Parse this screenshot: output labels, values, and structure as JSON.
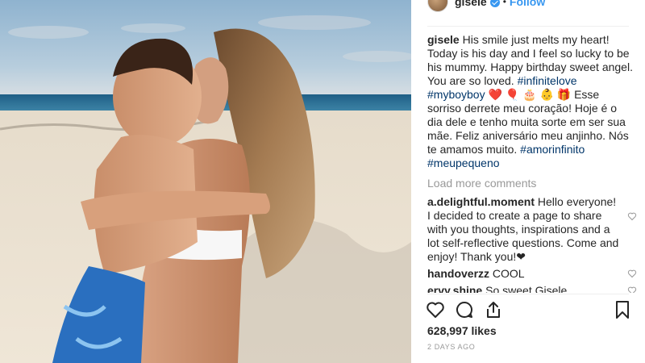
{
  "post": {
    "author": "gisele",
    "follow_label": "Follow",
    "dot": "•",
    "caption": {
      "text_en": "His smile just melts my heart! Today is his day and I feel so lucky to be his mummy. Happy birthday sweet angel. You are so loved.",
      "tag1": "#infinitelove",
      "tag2": "#myboyboy",
      "emoji_line": "❤️ 🎈 🎂 👶 🎁",
      "text_pt": "Esse sorriso derrete meu coração! Hoje é o dia dele e tenho muita sorte em ser sua mãe. Feliz aniversário meu anjinho. Nós te amamos muito.",
      "tag3": "#amorinfinito",
      "tag4": "#meupequeno"
    },
    "load_more": "Load more comments",
    "comments": [
      {
        "user": "a.delightful.moment",
        "text": "Hello everyone! I decided to create a page to share with you thoughts, inspirations and a lot self-reflective questions. Come and enjoy! Thank you!❤"
      },
      {
        "user": "handoverzz",
        "text": "COOL"
      },
      {
        "user": "ervy.shine",
        "text": "So sweet Gisele Bundchen! ;-)"
      }
    ],
    "likes": "628,997 likes",
    "timestamp": "2 DAYS AGO"
  },
  "colors": {
    "link": "#003569",
    "follow": "#3897f0",
    "muted": "#999999"
  },
  "icons": [
    "verified-icon",
    "heart-icon",
    "comment-icon",
    "share-icon",
    "bookmark-icon"
  ]
}
